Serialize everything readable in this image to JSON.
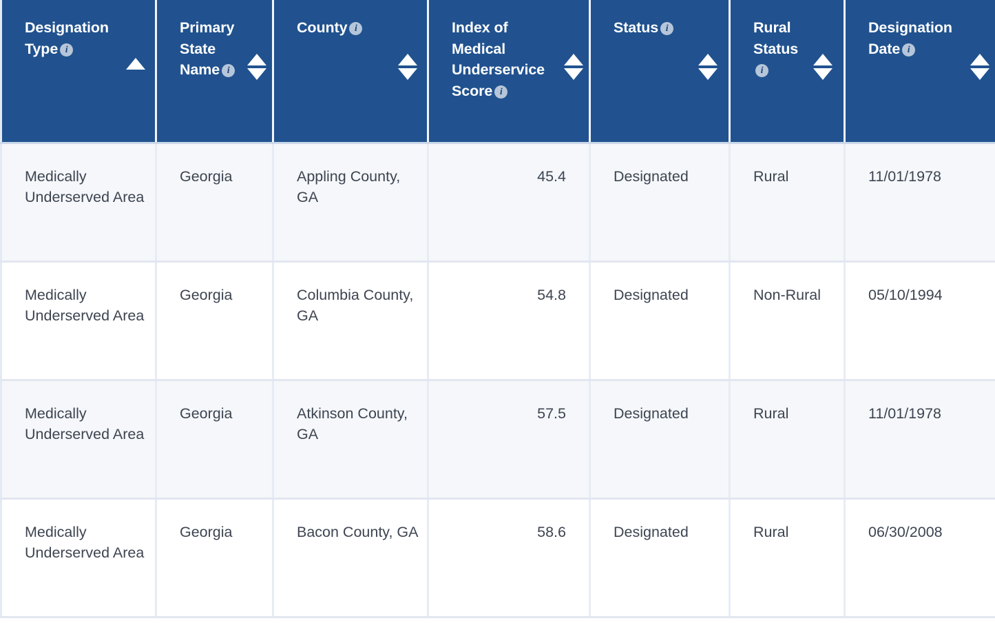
{
  "table": {
    "columns": [
      {
        "key": "designation_type",
        "label": "Designation Type",
        "has_info": true,
        "sort": "asc",
        "align": "left"
      },
      {
        "key": "primary_state",
        "label": "Primary State Name",
        "has_info": true,
        "sort": "none",
        "align": "left"
      },
      {
        "key": "county",
        "label": "County",
        "has_info": true,
        "sort": "none",
        "align": "left"
      },
      {
        "key": "imu_score",
        "label": "Index of Medical Underservice Score",
        "has_info": true,
        "sort": "none",
        "align": "right"
      },
      {
        "key": "status",
        "label": "Status",
        "has_info": true,
        "sort": "none",
        "align": "left"
      },
      {
        "key": "rural_status",
        "label": "Rural Status",
        "has_info": true,
        "sort": "none",
        "align": "left"
      },
      {
        "key": "designation_date",
        "label": "Designation Date",
        "has_info": true,
        "sort": "none",
        "align": "left"
      }
    ],
    "info_icon": "info-icon",
    "sort_asc_icon": "sort-ascending-icon",
    "sort_none_icon": "sort-unsorted-icon",
    "rows": [
      {
        "designation_type": "Medically Underserved Area",
        "primary_state": "Georgia",
        "county": "Appling County, GA",
        "imu_score": "45.4",
        "status": "Designated",
        "rural_status": "Rural",
        "designation_date": "11/01/1978"
      },
      {
        "designation_type": "Medically Underserved Area",
        "primary_state": "Georgia",
        "county": "Columbia County, GA",
        "imu_score": "54.8",
        "status": "Designated",
        "rural_status": "Non-Rural",
        "designation_date": "05/10/1994"
      },
      {
        "designation_type": "Medically Underserved Area",
        "primary_state": "Georgia",
        "county": "Atkinson County, GA",
        "imu_score": "57.5",
        "status": "Designated",
        "rural_status": "Rural",
        "designation_date": "11/01/1978"
      },
      {
        "designation_type": "Medically Underserved Area",
        "primary_state": "Georgia",
        "county": "Bacon County, GA",
        "imu_score": "58.6",
        "status": "Designated",
        "rural_status": "Rural",
        "designation_date": "06/30/2008"
      }
    ]
  },
  "colors": {
    "header_background": "#21528f",
    "header_text": "#ffffff",
    "stripe_row_background": "#f5f7fa",
    "plain_row_background": "#ffffff",
    "cell_text": "#3d4551",
    "cell_border": "#e1e6f0",
    "info_icon_background": "#b6c6da"
  }
}
